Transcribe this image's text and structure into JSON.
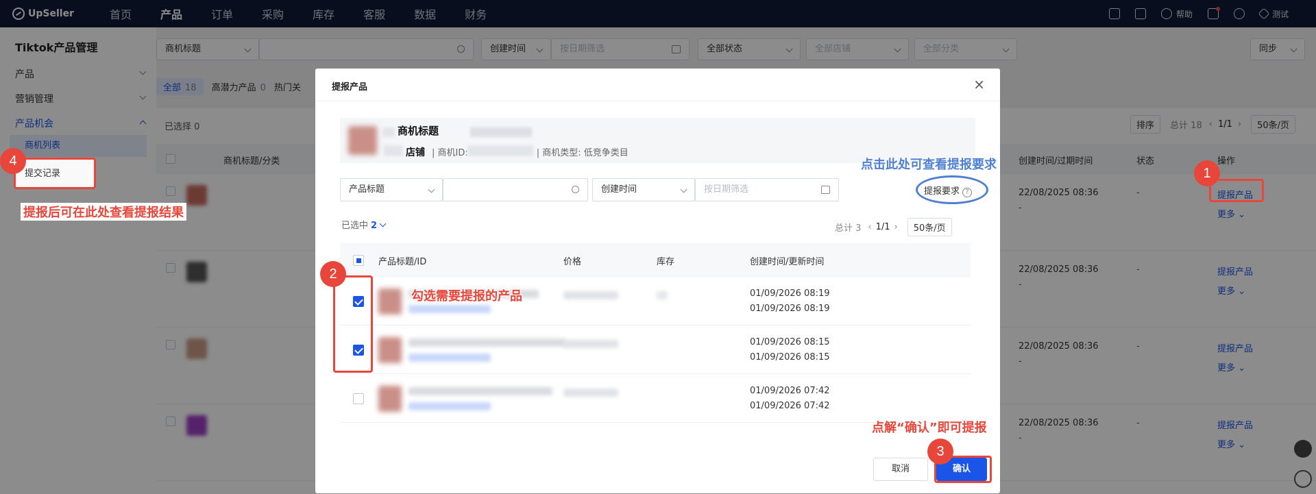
{
  "topbar": {
    "brand": "UpSeller",
    "nav": [
      "首页",
      "产品",
      "订单",
      "采购",
      "库存",
      "客服",
      "数据",
      "财务"
    ],
    "active_nav": "产品",
    "help": "帮助",
    "user": "测试"
  },
  "sidebar": {
    "title": "Tiktok产品管理",
    "groups": [
      "产品",
      "营销管理",
      "产品机会"
    ],
    "items": [
      "商机列表",
      "提交记录"
    ]
  },
  "filters": {
    "field_select": "商机标题",
    "time_select": "创建时间",
    "date_placeholder": "按日期筛选",
    "status_select": "全部状态",
    "store_select": "全部店铺",
    "category_select": "全部分类",
    "sync_button": "同步"
  },
  "tabs": [
    {
      "label": "全部",
      "count": "18"
    },
    {
      "label": "高潜力产品",
      "count": "0"
    },
    {
      "label": "热门关",
      "count": ""
    }
  ],
  "list": {
    "selected": "已选择 0",
    "sort": "排序",
    "total": "总计 18",
    "page": "1/1",
    "per_page": "50条/页",
    "headers": {
      "title": "商机标题/分类",
      "time": "创建时间/过期时间",
      "status": "状态",
      "op": "操作"
    },
    "rows": [
      {
        "time": "22/08/2025 08:36",
        "sub": "-",
        "status": "-",
        "action": "提报产品",
        "more": "更多"
      },
      {
        "time": "22/08/2025 08:36",
        "sub": "-",
        "status": "-",
        "action": "提报产品",
        "more": "更多"
      },
      {
        "time": "22/08/2025 08:36",
        "sub": "-",
        "status": "-",
        "action": "提报产品",
        "more": "更多"
      },
      {
        "time": "22/08/2025 08:36",
        "sub": "-",
        "status": "-",
        "action": "提报产品",
        "more": "更多"
      }
    ]
  },
  "modal": {
    "title": "提报产品",
    "info_title": "商机标题",
    "info_store": "店铺",
    "info_meta_id": "| 商机ID:",
    "info_meta_type": "| 商机类型: 低竞争类目",
    "field_select": "产品标题",
    "time_select": "创建时间",
    "date_placeholder": "按日期筛选",
    "requirements": "提报要求",
    "selected_label": "已选中",
    "selected_count": "2",
    "total": "总计 3",
    "page": "1/1",
    "per_page": "50条/页",
    "headers": {
      "title": "产品标题/ID",
      "price": "价格",
      "stock": "库存",
      "time": "创建时间/更新时间"
    },
    "rows": [
      {
        "checked": true,
        "created": "01/09/2026 08:19",
        "updated": "01/09/2026 08:19"
      },
      {
        "checked": true,
        "created": "01/09/2026 08:15",
        "updated": "01/09/2026 08:15"
      },
      {
        "checked": false,
        "created": "01/09/2026 07:42",
        "updated": "01/09/2026 07:42"
      }
    ],
    "cancel": "取消",
    "confirm": "确认"
  },
  "annotations": {
    "n1": "1",
    "n2": "2",
    "n3": "3",
    "n4": "4",
    "check_hint": "勾选需要提报的产品",
    "req_hint": "点击此处可查看提报要求",
    "confirm_hint": "点解“确认”即可提报",
    "record_hint": "提报后可在此处查看提报结果"
  }
}
